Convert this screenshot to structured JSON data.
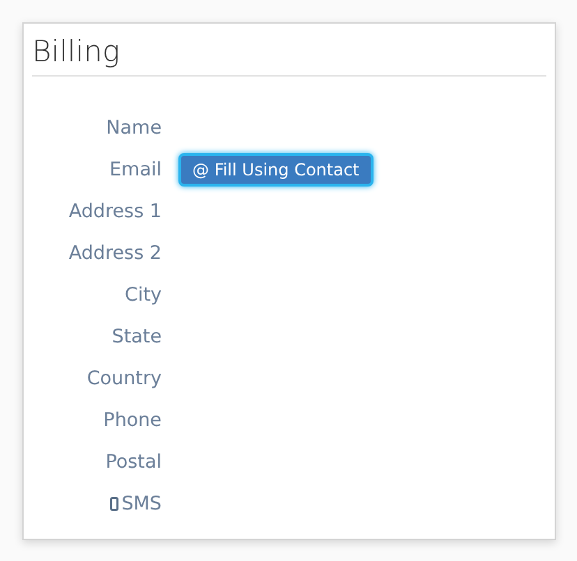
{
  "section": {
    "title": "Billing"
  },
  "fields": [
    {
      "label": "Name",
      "kind": "plain"
    },
    {
      "label": "Email",
      "kind": "plain",
      "button": "@ Fill Using Contact"
    },
    {
      "label": "Address 1",
      "kind": "plain"
    },
    {
      "label": "Address 2",
      "kind": "plain"
    },
    {
      "label": "City",
      "kind": "plain"
    },
    {
      "label": "State",
      "kind": "plain"
    },
    {
      "label": "Country",
      "kind": "plain"
    },
    {
      "label": "Phone",
      "kind": "plain"
    },
    {
      "label": "Postal",
      "kind": "plain"
    },
    {
      "label": "SMS",
      "kind": "mobile"
    }
  ]
}
